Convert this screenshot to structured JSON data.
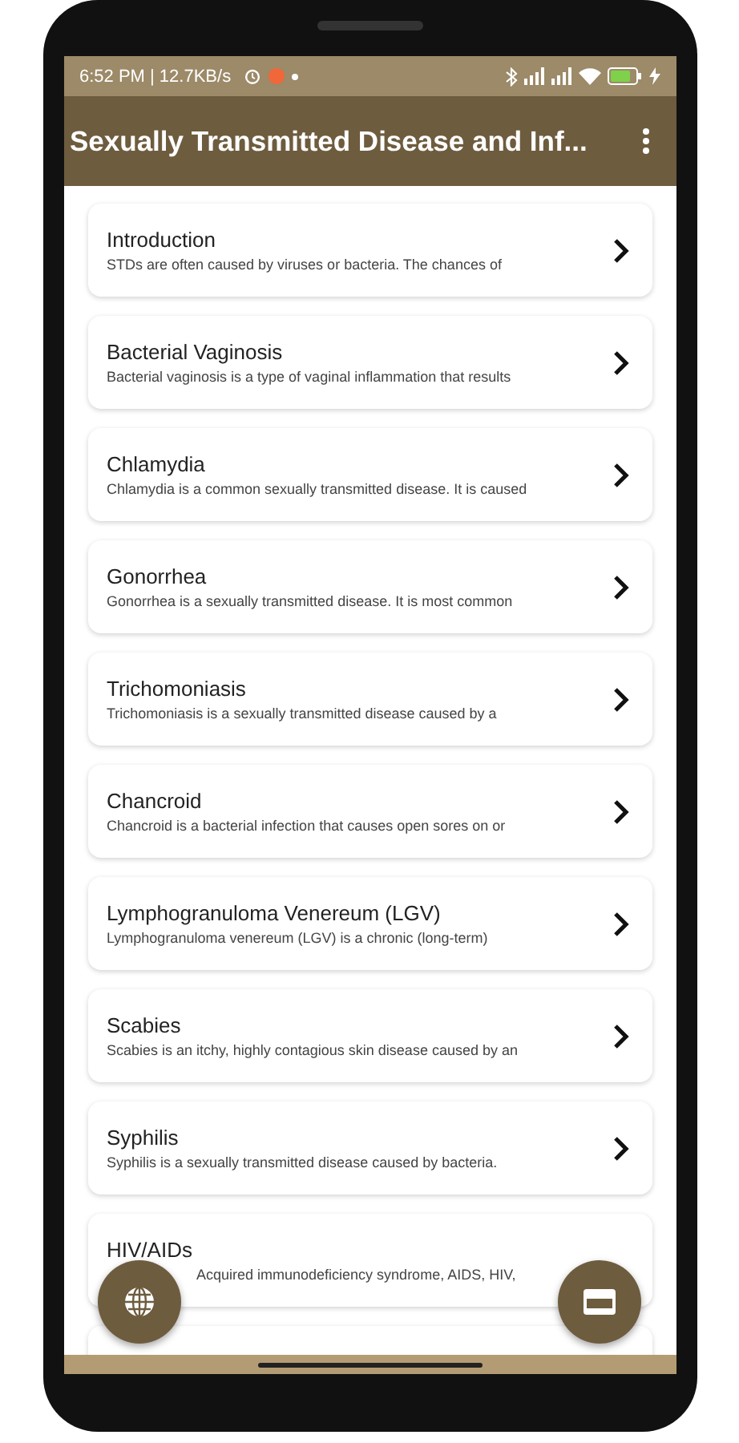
{
  "status_bar": {
    "time": "6:52 PM | 12.7KB/s"
  },
  "app_bar": {
    "title": "Sexually Transmitted Disease and Inf..."
  },
  "topics": [
    {
      "title": "Introduction",
      "summary": "STDs are often caused by viruses or bacteria. The chances of"
    },
    {
      "title": "Bacterial Vaginosis",
      "summary": "Bacterial vaginosis is a type of vaginal inflammation that results"
    },
    {
      "title": "Chlamydia",
      "summary": "Chlamydia is a common sexually transmitted disease. It is caused"
    },
    {
      "title": "Gonorrhea",
      "summary": "Gonorrhea is a sexually transmitted disease. It is most common"
    },
    {
      "title": "Trichomoniasis",
      "summary": "Trichomoniasis is a sexually transmitted disease caused by a"
    },
    {
      "title": "Chancroid",
      "summary": "Chancroid is a bacterial infection that causes open sores on or"
    },
    {
      "title": "Lymphogranuloma Venereum (LGV)",
      "summary": "Lymphogranuloma venereum (LGV) is a chronic (long-term)"
    },
    {
      "title": "Scabies",
      "summary": "Scabies is an itchy, highly contagious skin disease caused by an"
    },
    {
      "title": "Syphilis",
      "summary": "Syphilis is a sexually transmitted disease caused by bacteria."
    },
    {
      "title": "HIV/AIDs",
      "summary": "Acquired immunodeficiency syndrome, AIDS, HIV,"
    }
  ]
}
